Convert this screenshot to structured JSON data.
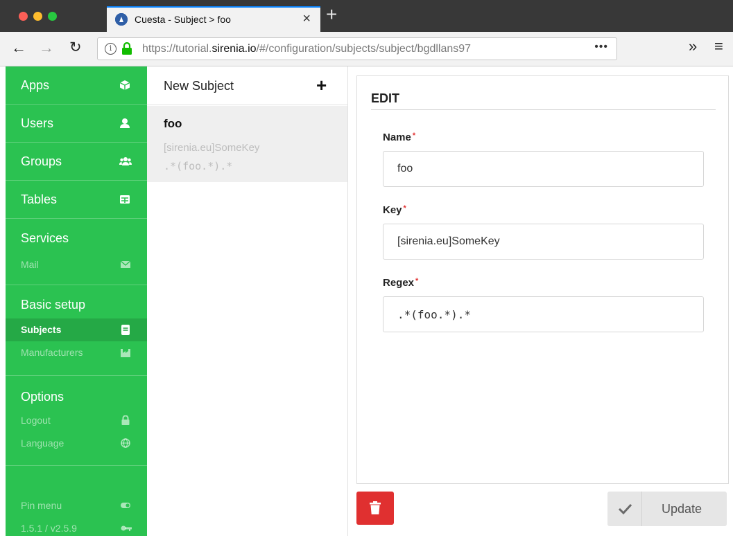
{
  "browser": {
    "tab_title": "Cuesta - Subject > foo",
    "url_prefix": "https://tutorial.",
    "url_host": "sirenia.io",
    "url_path": "/#/configuration/subjects/subject/bgdllans97",
    "url_more": "•••"
  },
  "sidebar": {
    "items": [
      {
        "label": "Apps",
        "icon": "cube-icon"
      },
      {
        "label": "Users",
        "icon": "user-icon"
      },
      {
        "label": "Groups",
        "icon": "users-icon"
      },
      {
        "label": "Tables",
        "icon": "table-icon"
      }
    ],
    "groups": [
      {
        "title": "Services",
        "items": [
          {
            "label": "Mail",
            "icon": "envelope-icon"
          }
        ]
      },
      {
        "title": "Basic setup",
        "items": [
          {
            "label": "Subjects",
            "icon": "book-icon",
            "active": true
          },
          {
            "label": "Manufacturers",
            "icon": "industry-icon"
          }
        ]
      },
      {
        "title": "Options",
        "items": [
          {
            "label": "Logout",
            "icon": "lock-icon"
          },
          {
            "label": "Language",
            "icon": "globe-icon"
          }
        ]
      }
    ],
    "footer": [
      {
        "label": "Pin menu",
        "icon": "toggle-icon"
      },
      {
        "label": "1.5.1 / v2.5.9",
        "icon": "key-icon"
      }
    ],
    "color": "#2bc251"
  },
  "list": {
    "header": "New Subject",
    "entries": [
      {
        "name": "foo",
        "key": "[sirenia.eu]SomeKey",
        "regex": ".*(foo.*).*"
      }
    ]
  },
  "edit": {
    "title": "EDIT",
    "fields": [
      {
        "label": "Name",
        "value": "foo",
        "required": "*"
      },
      {
        "label": "Key",
        "value": "[sirenia.eu]SomeKey",
        "required": "*"
      },
      {
        "label": "Regex",
        "value": ".*(foo.*).*",
        "required": "*"
      }
    ],
    "update_label": "Update",
    "delete_color": "#e03030"
  }
}
